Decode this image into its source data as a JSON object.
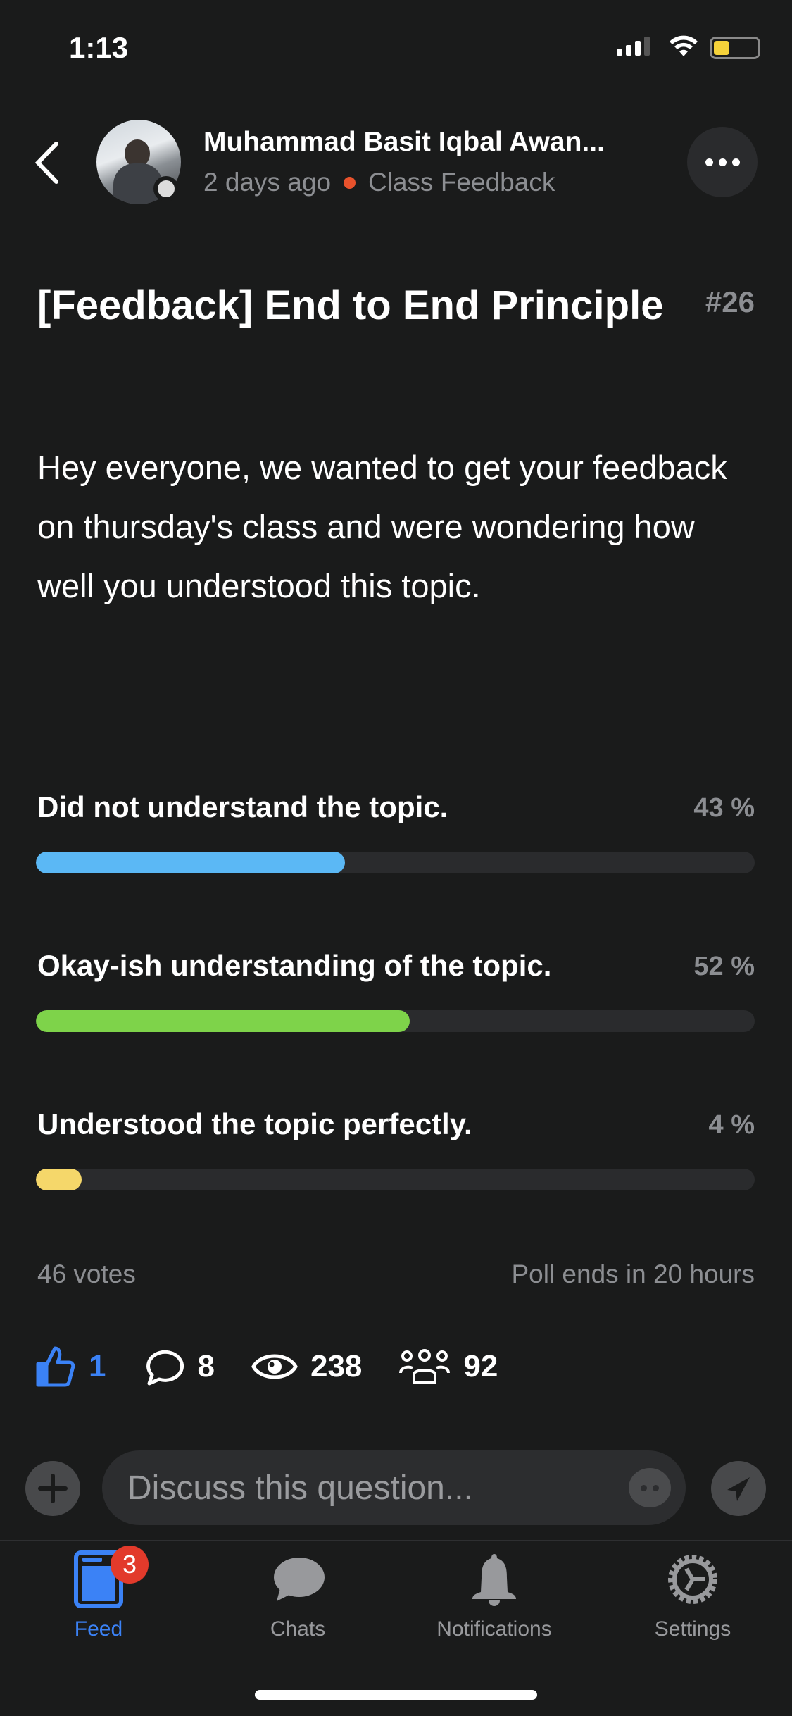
{
  "status_bar": {
    "time": "1:13"
  },
  "header": {
    "author": "Muhammad Basit Iqbal Awan...",
    "time_ago": "2 days ago",
    "category": "Class Feedback",
    "category_color": "#e8522c"
  },
  "post": {
    "title": "[Feedback] End to End Principle",
    "number": "#26",
    "body": "Hey everyone, we wanted to get your feedback on thursday's class and were wondering how well you understood this topic."
  },
  "poll": {
    "options": [
      {
        "label": "Did not understand the topic.",
        "percent_label": "43 %",
        "percent": 43,
        "color": "#5bb8f5"
      },
      {
        "label": "Okay-ish understanding of the topic.",
        "percent_label": "52 %",
        "percent": 52,
        "color": "#7ed34a"
      },
      {
        "label": "Understood the topic perfectly.",
        "percent_label": "4 %",
        "percent": 4,
        "color": "#f5d76a"
      }
    ],
    "votes": "46 votes",
    "ends": "Poll ends in 20 hours"
  },
  "stats": {
    "likes": "1",
    "comments": "8",
    "views": "238",
    "participants": "92",
    "like_color": "#3b82f6"
  },
  "composer": {
    "placeholder": "Discuss this question..."
  },
  "tabs": [
    {
      "label": "Feed",
      "badge": "3",
      "active": true
    },
    {
      "label": "Chats"
    },
    {
      "label": "Notifications"
    },
    {
      "label": "Settings"
    }
  ]
}
